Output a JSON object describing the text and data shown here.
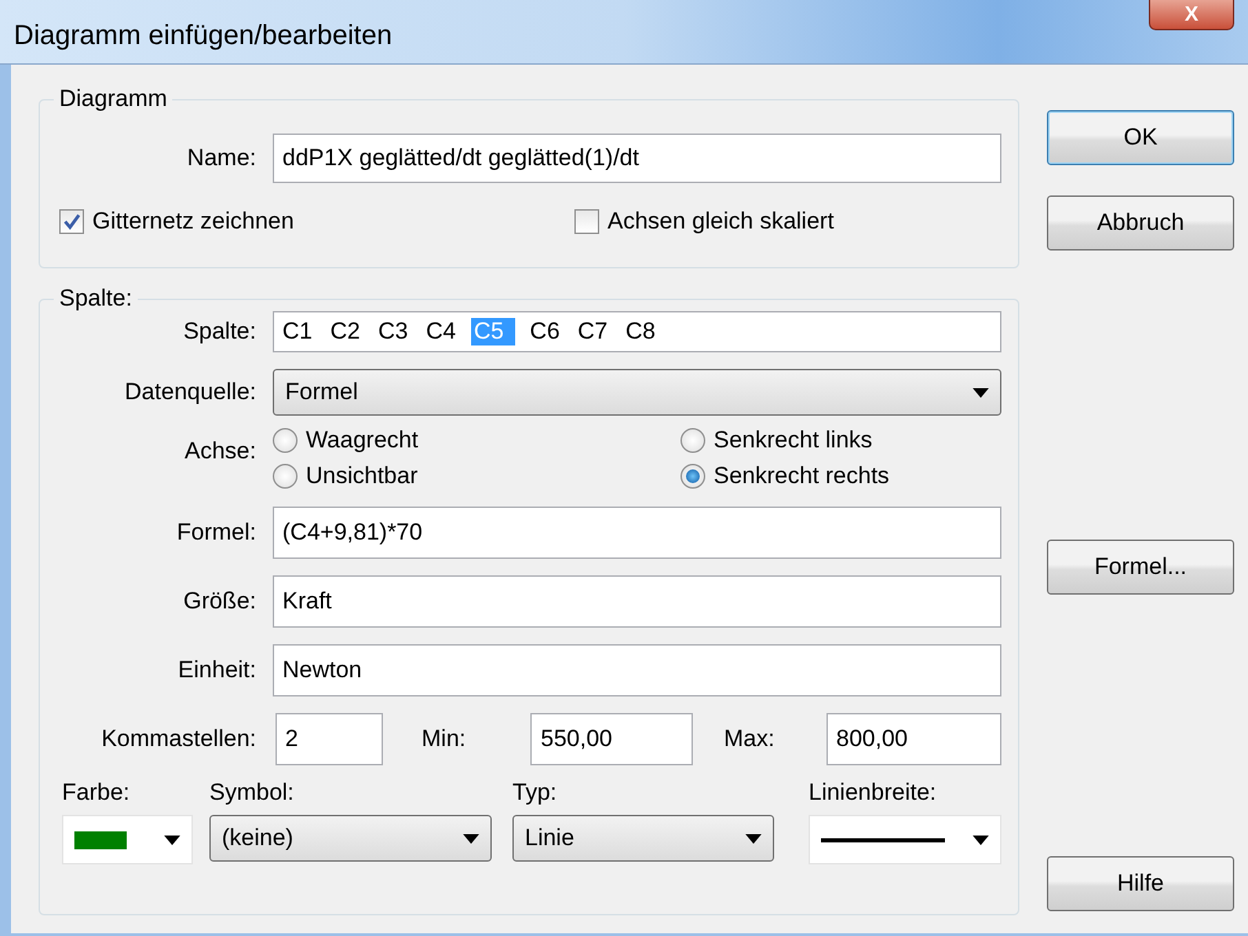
{
  "window": {
    "title": "Diagramm einfügen/bearbeiten",
    "close": "X"
  },
  "diagramm": {
    "legend": "Diagramm",
    "name_label": "Name:",
    "name_value": "ddP1X geglätted/dt geglätted(1)/dt",
    "checkboxes": [
      {
        "label": "Gitternetz zeichnen",
        "checked": true
      },
      {
        "label": "Achsen gleich skaliert",
        "checked": false
      }
    ]
  },
  "spalte": {
    "legend": "Spalte:",
    "spalte_label": "Spalte:",
    "columns": [
      {
        "label": "C1",
        "selected": false
      },
      {
        "label": "C2",
        "selected": false
      },
      {
        "label": "C3",
        "selected": false
      },
      {
        "label": "C4",
        "selected": false
      },
      {
        "label": "C5",
        "selected": true
      },
      {
        "label": "C6",
        "selected": false
      },
      {
        "label": "C7",
        "selected": false
      },
      {
        "label": "C8",
        "selected": false
      }
    ],
    "datenquelle_label": "Datenquelle:",
    "datenquelle_value": "Formel",
    "achse_label": "Achse:",
    "achse": [
      {
        "label": "Waagrecht",
        "selected": false
      },
      {
        "label": "Senkrecht links",
        "selected": false
      },
      {
        "label": "Unsichtbar",
        "selected": false
      },
      {
        "label": "Senkrecht rechts",
        "selected": true
      }
    ],
    "fields": [
      {
        "label": "Formel:",
        "value": "(C4+9,81)*70"
      },
      {
        "label": "Größe:",
        "value": "Kraft"
      },
      {
        "label": "Einheit:",
        "value": "Newton"
      }
    ],
    "kommastellen_label": "Kommastellen:",
    "kommastellen_value": "2",
    "min_label": "Min:",
    "min_value": "550,00",
    "max_label": "Max:",
    "max_value": "800,00",
    "farbe_label": "Farbe:",
    "symbol_label": "Symbol:",
    "symbol_value": "(keine)",
    "typ_label": "Typ:",
    "typ_value": "Linie",
    "linienbreite_label": "Linienbreite:"
  },
  "buttons": [
    {
      "label": "OK",
      "kind": "default"
    },
    {
      "label": "Abbruch",
      "kind": "normal"
    },
    {
      "label": "Formel...",
      "kind": "normal"
    },
    {
      "label": "Hilfe",
      "kind": "normal"
    }
  ]
}
